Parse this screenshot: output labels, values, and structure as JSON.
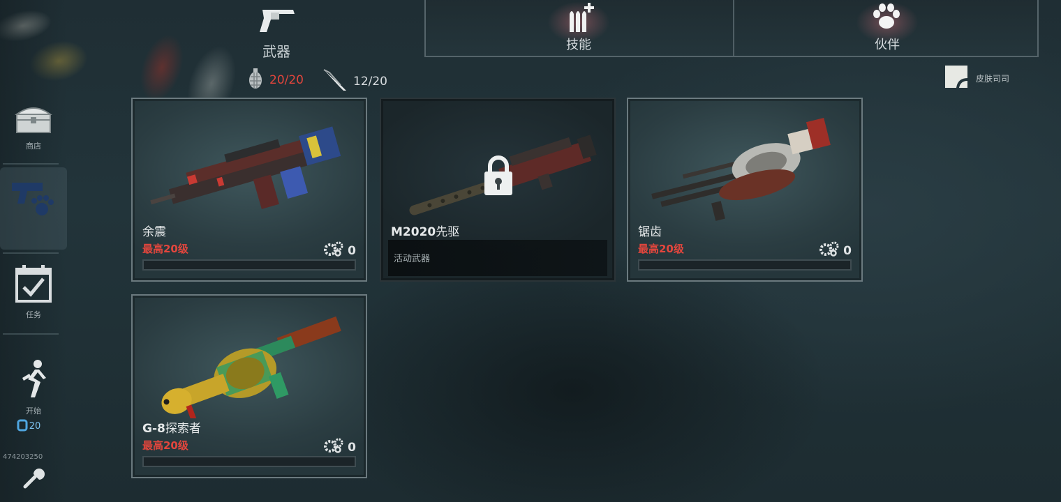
{
  "sidebar": {
    "items": [
      {
        "label": "商店",
        "icon": "treasure-chest-icon"
      },
      {
        "label": "",
        "icon": "gun-paw-icon",
        "active": true
      },
      {
        "label": "任务",
        "icon": "calendar-check-icon"
      },
      {
        "label": "开始",
        "icon": "running-man-icon",
        "cost": "20",
        "cost_icon": "energy-icon"
      },
      {
        "label": "",
        "icon": "wrench-icon"
      }
    ],
    "player_id": "474203250"
  },
  "top_tabs": {
    "weapons": {
      "label": "武器",
      "icon": "revolver-icon"
    },
    "skills": {
      "label": "技能",
      "icon": "bullets-plus-icon"
    },
    "partners": {
      "label": "伙伴",
      "icon": "paw-icon"
    }
  },
  "counters": {
    "primary": {
      "value": "20/20",
      "icon": "grenade-icon"
    },
    "melee": {
      "value": "12/20",
      "icon": "knife-icon"
    }
  },
  "skin_button": {
    "label": "皮肤司司",
    "icon": "skin-card-icon"
  },
  "weapons": [
    {
      "name": "余震",
      "level": "最高20级",
      "parts": "0",
      "locked": false
    },
    {
      "name_prefix": "M2020",
      "name_suffix": "先驱",
      "note": "活动武器",
      "locked": true
    },
    {
      "name": "锯齿",
      "level": "最高20级",
      "parts": "0",
      "locked": false
    },
    {
      "name_prefix": "G-8",
      "name_suffix": "探索者",
      "level": "最高20级",
      "parts": "0",
      "locked": false
    }
  ],
  "colors": {
    "accent_red": "#e0453c",
    "card_border": "#6b7a7f",
    "background": "#22343a"
  }
}
